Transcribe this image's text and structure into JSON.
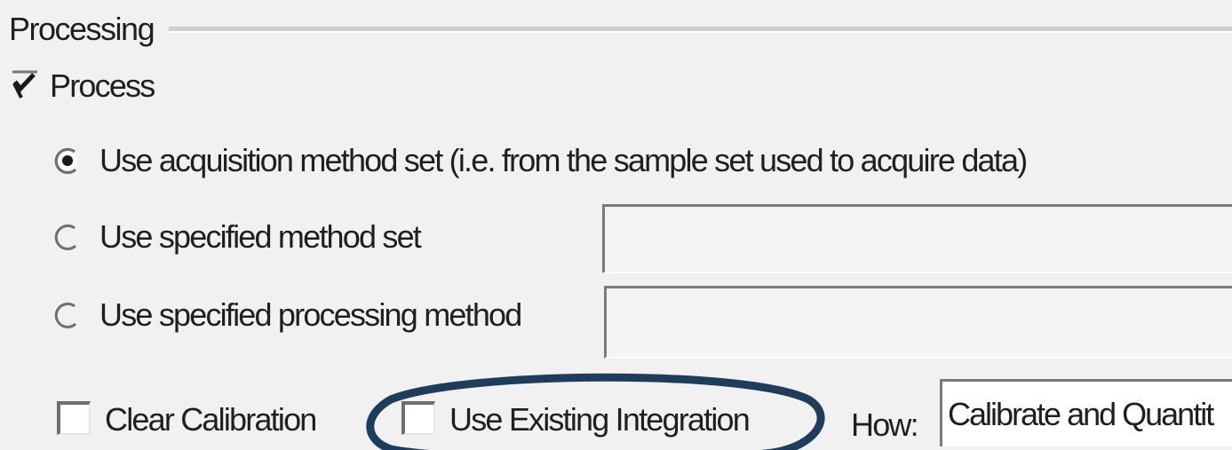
{
  "processing_group": {
    "title": "Processing",
    "process_checkbox": {
      "label": "Process",
      "checked": true
    },
    "options": [
      {
        "label": "Use acquisition method set  (i.e. from the sample set used to acquire data)",
        "selected": true
      },
      {
        "label": "Use specified method set",
        "selected": false,
        "field_value": ""
      },
      {
        "label": "Use specified processing method",
        "selected": false,
        "field_value": ""
      }
    ],
    "clear_calibration": {
      "label": "Clear Calibration",
      "checked": false
    },
    "use_existing_integration": {
      "label": "Use Existing Integration",
      "checked": false
    },
    "how": {
      "label": "How:",
      "value": "Calibrate and Quantit"
    }
  },
  "colors": {
    "highlight_ellipse": "#1e3d5c",
    "background": "#f1f1f1"
  }
}
